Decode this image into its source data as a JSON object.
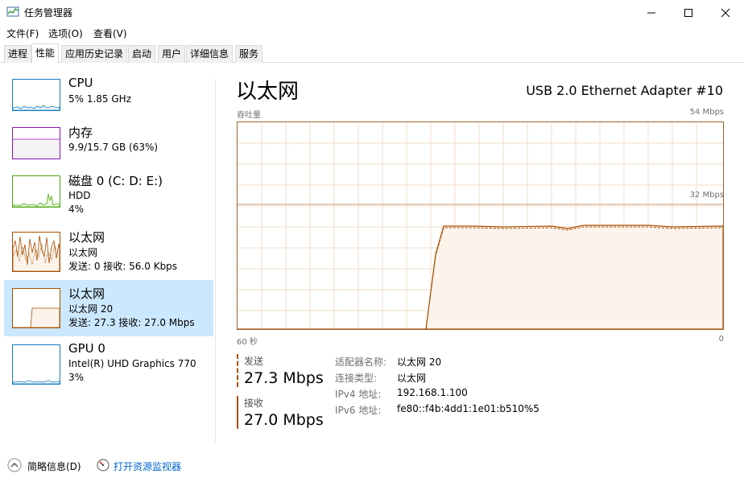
{
  "window": {
    "title": "任务管理器",
    "app_icon": "task-manager-icon",
    "controls": [
      "minimize-icon",
      "maximize-icon",
      "close-icon"
    ]
  },
  "menu": [
    "文件(F)",
    "选项(O)",
    "查看(V)"
  ],
  "tabs": [
    "进程",
    "性能",
    "应用历史记录",
    "启动",
    "用户",
    "详细信息",
    "服务"
  ],
  "active_tab": "性能",
  "sidebar": {
    "items": [
      {
        "name": "CPU",
        "line1": "5% 1.85 GHz",
        "line2": "",
        "color": "#117dbb"
      },
      {
        "name": "内存",
        "line1": "9.9/15.7 GB (63%)",
        "line2": "",
        "color": "#8b12ae"
      },
      {
        "name": "磁盘 0 (C: D: E:)",
        "line1": "HDD",
        "line2": "4%",
        "color": "#4da60c"
      },
      {
        "name": "以太网",
        "line1": "以太网",
        "line2": "发送: 0 接收: 56.0 Kbps",
        "color": "#a74f01"
      },
      {
        "name": "以太网",
        "line1": "以太网 20",
        "line2": "发送: 27.3 接收: 27.0 Mbps",
        "color": "#a74f01",
        "selected": true
      },
      {
        "name": "GPU 0",
        "line1": "Intel(R) UHD Graphics 770",
        "line2": "3%",
        "color": "#117dbb"
      }
    ]
  },
  "main": {
    "title": "以太网",
    "adapter": "USB 2.0 Ethernet Adapter #10",
    "graph_label": "吞吐量",
    "graph_max": "54 Mbps",
    "graph_mid": "32 Mbps",
    "time_left": "60 秒",
    "time_right": "0",
    "accent": "#a74f01"
  },
  "stats": {
    "send_label": "发送",
    "send_value": "27.3 Mbps",
    "recv_label": "接收",
    "recv_value": "27.0 Mbps"
  },
  "info": [
    {
      "label": "适配器名称:",
      "value": "以太网 20"
    },
    {
      "label": "连接类型:",
      "value": "以太网"
    },
    {
      "label": "IPv4 地址:",
      "value": "192.168.1.100"
    },
    {
      "label": "IPv6 地址:",
      "value": "fe80::f4b:4dd1:1e01:b510%5"
    }
  ],
  "footer": {
    "fewer_details": "简略信息(D)",
    "resource_monitor": "打开资源监视器"
  }
}
